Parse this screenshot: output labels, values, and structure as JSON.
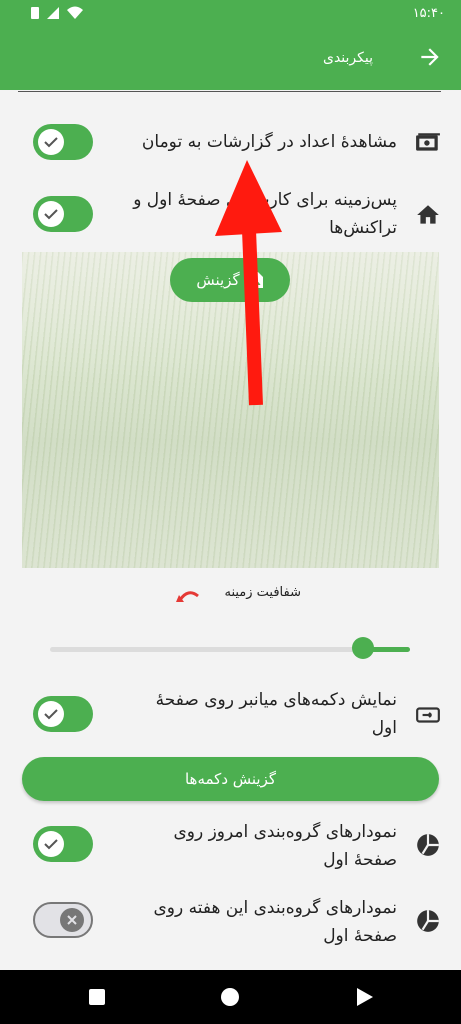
{
  "status_bar": {
    "time": "۱۵:۴۰"
  },
  "app_bar": {
    "title": "پیکربندی",
    "back_icon": "arrow-right-icon"
  },
  "settings": {
    "show_numbers_toman": {
      "label": "مشاهدهٔ اعداد در گزارشات به تومان",
      "enabled": true,
      "icon": "money-icon"
    },
    "background_home": {
      "label": "پس‌زمینه برای کارت‌های صفحهٔ اول و تراکنش‌ها",
      "enabled": true,
      "icon": "home-icon"
    },
    "choose_image_button": "گزینش",
    "opacity": {
      "label": "شفافیت زمینه",
      "value_fraction": 0.88
    },
    "shortcut_buttons": {
      "label": "نمایش دکمه‌های میانبر روی صفحهٔ اول",
      "enabled": true,
      "icon": "keyboard-icon"
    },
    "choose_buttons": "گزینش دکمه‌ها",
    "today_charts": {
      "label": "نمودارهای گروه‌بندی امروز روی صفحهٔ اول",
      "enabled": true,
      "icon": "pie-chart-icon"
    },
    "week_charts": {
      "label": "نمودارهای گروه‌بندی این هفته روی صفحهٔ اول",
      "enabled": false,
      "icon": "pie-chart-icon"
    }
  },
  "colors": {
    "primary": "#4caf50",
    "arrow": "#ff1a0f"
  }
}
